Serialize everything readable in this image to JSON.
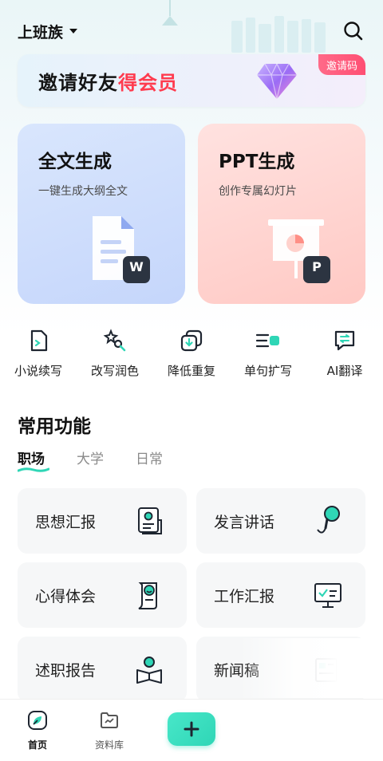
{
  "header": {
    "role_label": "上班族",
    "search_icon": "search-icon"
  },
  "invite_banner": {
    "text_plain": "邀请好友",
    "text_highlight": "得会员",
    "badge": "邀请码",
    "highlight_color": "#ff3b4e"
  },
  "cards": [
    {
      "title": "全文生成",
      "subtitle": "一键生成大纲全文",
      "badge_letter": "W",
      "icon": "document-icon"
    },
    {
      "title": "PPT生成",
      "subtitle": "创作专属幻灯片",
      "badge_letter": "P",
      "icon": "presentation-icon"
    }
  ],
  "tools": [
    {
      "label": "小说续写",
      "icon": "novel-continue-icon"
    },
    {
      "label": "改写润色",
      "icon": "polish-icon"
    },
    {
      "label": "降低重复",
      "icon": "reduce-duplicate-icon"
    },
    {
      "label": "单句扩写",
      "icon": "expand-sentence-icon"
    },
    {
      "label": "AI翻译",
      "icon": "translate-icon"
    }
  ],
  "common": {
    "title": "常用功能",
    "tabs": [
      "职场",
      "大学",
      "日常"
    ],
    "active_tab": "职场",
    "items": [
      {
        "label": "思想汇报",
        "icon": "report-icon"
      },
      {
        "label": "发言讲话",
        "icon": "microphone-icon"
      },
      {
        "label": "心得体会",
        "icon": "scroll-icon"
      },
      {
        "label": "工作汇报",
        "icon": "monitor-icon"
      },
      {
        "label": "述职报告",
        "icon": "reading-person-icon"
      },
      {
        "label": "新闻稿",
        "icon": "newspaper-icon"
      }
    ]
  },
  "bottom_nav": {
    "items": [
      {
        "label": "首页",
        "icon": "home-leaf-icon",
        "active": true
      },
      {
        "label": "资料库",
        "icon": "folder-icon",
        "active": false
      }
    ],
    "plus_icon": "plus-icon"
  },
  "colors": {
    "accent": "#2fd6b6",
    "full_card": "#c5d6fb",
    "ppt_card": "#ffc9c4",
    "icon_dark": "#2c3441"
  }
}
